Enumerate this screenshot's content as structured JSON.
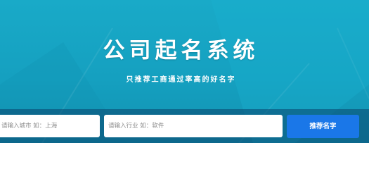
{
  "hero": {
    "title": "公司起名系统",
    "subtitle": "只推荐工商通过率高的好名字"
  },
  "search": {
    "city_placeholder": "请输入城市 如：上海",
    "industry_placeholder": "请输入行业 如：软件",
    "submit_label": "推荐名字"
  },
  "colors": {
    "background": "#16a3c3",
    "search_bar": "#0d5f86",
    "button": "#1a77e8",
    "text": "#ffffff"
  }
}
